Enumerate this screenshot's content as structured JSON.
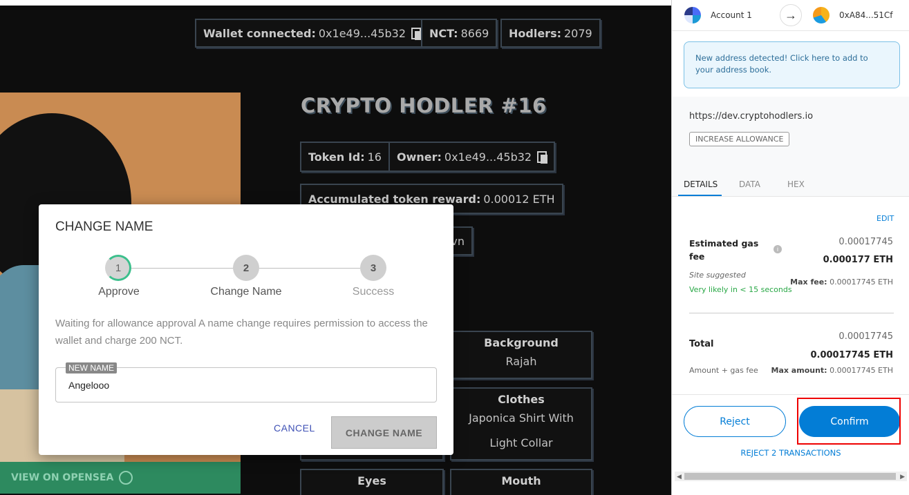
{
  "topbar": {
    "wallet_label": "Wallet connected:",
    "wallet_value": "0x1e49...45b32",
    "nct_label": "NCT:",
    "nct_value": "8669",
    "hodlers_label": "Hodlers:",
    "hodlers_value": "2079"
  },
  "nft": {
    "title": "CRYPTO HODLER #16",
    "token_id_label": "Token Id:",
    "token_id_value": "16",
    "owner_label": "Owner:",
    "owner_value": "0x1e49...45b32",
    "reward_label": "Accumulated token reward:",
    "reward_value": "0.00012 ETH",
    "partial_text": "vn",
    "opensea_label": "VIEW ON OPENSEA",
    "traits": [
      {
        "key": "Background",
        "value": "Rajah"
      },
      {
        "key": "Clothes",
        "value": "Japonica Shirt With Light Collar"
      },
      {
        "key": "Eyes",
        "value": ""
      },
      {
        "key": "Mouth",
        "value": ""
      }
    ]
  },
  "modal": {
    "title": "CHANGE NAME",
    "steps": [
      {
        "num": "1",
        "label": "Approve"
      },
      {
        "num": "2",
        "label": "Change Name"
      },
      {
        "num": "3",
        "label": "Success"
      }
    ],
    "message": "Waiting for allowance approval A name change requires permission to access the wallet and charge 200 NCT.",
    "field_label": "NEW NAME",
    "field_value": "Angelooo",
    "cancel_label": "CANCEL",
    "submit_label": "CHANGE NAME"
  },
  "metamask": {
    "from_account": "Account 1",
    "to_address": "0xA84...51Cf",
    "notice": "New address detected! Click here to add to your address book.",
    "origin": "https://dev.cryptohodlers.io",
    "action_badge": "INCREASE ALLOWANCE",
    "tabs": [
      "DETAILS",
      "DATA",
      "HEX"
    ],
    "edit_label": "EDIT",
    "gas_label": "Estimated gas fee",
    "gas_value_small": "0.00017745",
    "gas_value": "0.000177 ETH",
    "site_suggested": "Site suggested",
    "likelihood": "Very likely in < 15 seconds",
    "max_fee_label": "Max fee:",
    "max_fee_value": "0.00017745 ETH",
    "total_label": "Total",
    "total_value_small": "0.00017745",
    "total_value": "0.00017745 ETH",
    "amount_gas_label": "Amount + gas fee",
    "max_amount_label": "Max amount:",
    "max_amount_value": "0.00017745 ETH",
    "reject_label": "Reject",
    "confirm_label": "Confirm",
    "reject_all_label": "REJECT 2 TRANSACTIONS",
    "colors": {
      "accent": "#037dd6",
      "success": "#28a745",
      "highlight": "#e00000"
    }
  }
}
